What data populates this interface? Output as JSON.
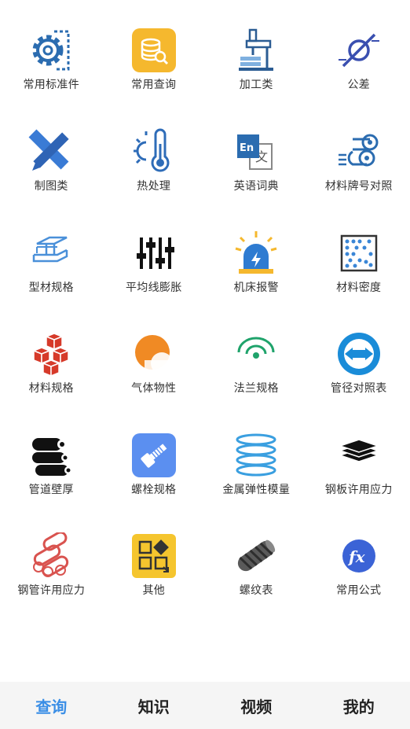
{
  "grid": {
    "items": [
      {
        "label": "常用标准件",
        "icon": "gear-doc-icon"
      },
      {
        "label": "常用查询",
        "icon": "coin-search-icon"
      },
      {
        "label": "加工类",
        "icon": "microscope-machine-icon"
      },
      {
        "label": "公差",
        "icon": "tolerance-symbol-icon"
      },
      {
        "label": "制图类",
        "icon": "pencil-ruler-icon"
      },
      {
        "label": "热处理",
        "icon": "thermometer-sun-icon"
      },
      {
        "label": "英语词典",
        "icon": "english-dictionary-icon"
      },
      {
        "label": "材料牌号对照",
        "icon": "material-rolls-icon"
      },
      {
        "label": "型材规格",
        "icon": "i-beam-icon"
      },
      {
        "label": "平均线膨胀",
        "icon": "sliders-icon"
      },
      {
        "label": "机床报警",
        "icon": "alarm-light-icon"
      },
      {
        "label": "材料密度",
        "icon": "density-dots-icon"
      },
      {
        "label": "材料规格",
        "icon": "cubes-icon"
      },
      {
        "label": "气体物性",
        "icon": "gas-bubble-icon"
      },
      {
        "label": "法兰规格",
        "icon": "flange-icon"
      },
      {
        "label": "管径对照表",
        "icon": "pipe-diameter-icon"
      },
      {
        "label": "管道壁厚",
        "icon": "pipes-icon"
      },
      {
        "label": "螺栓规格",
        "icon": "bolt-icon"
      },
      {
        "label": "金属弹性模量",
        "icon": "spring-coil-icon"
      },
      {
        "label": "钢板许用应力",
        "icon": "steel-plates-icon"
      },
      {
        "label": "钢管许用应力",
        "icon": "steel-pipes-icon"
      },
      {
        "label": "其他",
        "icon": "other-apps-icon"
      },
      {
        "label": "螺纹表",
        "icon": "thread-rod-icon"
      },
      {
        "label": "常用公式",
        "icon": "formula-fx-icon"
      }
    ]
  },
  "tabbar": {
    "tabs": [
      {
        "label": "查询",
        "active": true
      },
      {
        "label": "知识",
        "active": false
      },
      {
        "label": "视频",
        "active": false
      },
      {
        "label": "我的",
        "active": false
      }
    ]
  },
  "colors": {
    "accent": "#3a8ee6",
    "icon_blue": "#2f6fb5",
    "icon_yellow": "#f5b82e",
    "icon_red": "#d63a2a"
  }
}
